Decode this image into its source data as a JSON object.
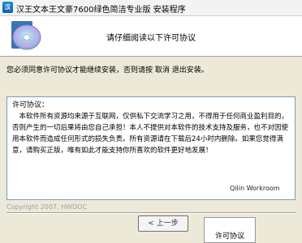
{
  "window": {
    "title": "汉王文本王文豪7600绿色简洁专业版 安装程序",
    "icon": "installer-app-icon"
  },
  "header": {
    "title": "请仔细阅读以下许可协议",
    "graphic": "cd-disc-icon"
  },
  "instruction": "您必须同意许可协议才能继续安装，否则请按 取消 退出安装。",
  "license": {
    "heading": "许可协议：",
    "body": "本软件所有资源均来源于互联网，仅供私下交流学习之用，不得用于任何商业盈利目的，否则产生的一切后果将由您自己承担！本人不提供对本软件的技术支持及服务，也不对因使用本软件而造成任何形式的损失负责。所有资源请在下载后24小时内删除。如果您觉得满意，请购买正版，唯有如此才能支持你所喜欢的软件更好地发展！"
  },
  "watermark": "Qilin Workroom",
  "copyright": "Copyright 2007, HWDOC",
  "buttons": {
    "back": "< 上一步"
  },
  "popup": {
    "label": "许可协议"
  }
}
